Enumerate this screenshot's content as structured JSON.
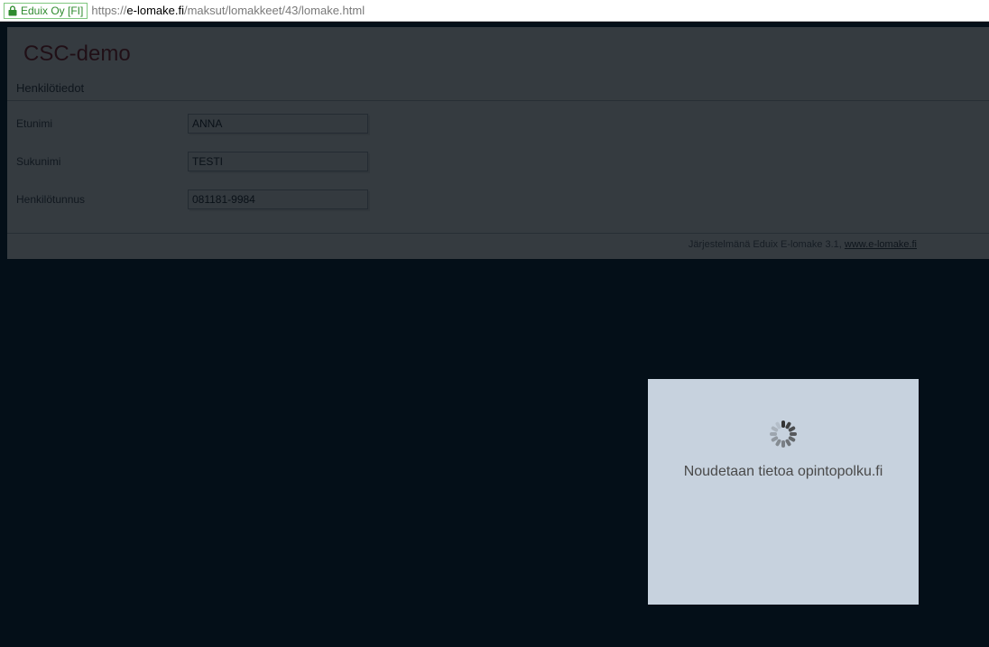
{
  "address_bar": {
    "cert_label": "Eduix Oy [FI]",
    "url_prefix": "https://",
    "url_host": "e-lomake.fi",
    "url_path": "/maksut/lomakkeet/43/lomake.html"
  },
  "form": {
    "title": "CSC-demo",
    "section": "Henkilötiedot",
    "fields": {
      "firstname": {
        "label": "Etunimi",
        "value": "ANNA"
      },
      "lastname": {
        "label": "Sukunimi",
        "value": "TESTI"
      },
      "ssn": {
        "label": "Henkilötunnus",
        "value": "081181-9984"
      }
    },
    "footer_text": "Järjestelmänä Eduix E-lomake 3.1, ",
    "footer_link": "www.e-lomake.fi"
  },
  "modal": {
    "message": "Noudetaan tietoa opintopolku.fi"
  }
}
